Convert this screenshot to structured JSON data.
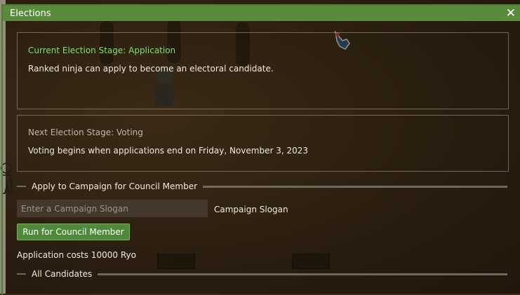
{
  "window": {
    "title": "Elections",
    "close_glyph": "✕"
  },
  "current_stage": {
    "heading": "Current Election Stage: Application",
    "description": "Ranked ninja can apply to become an electoral candidate."
  },
  "next_stage": {
    "heading": "Next Election Stage: Voting",
    "description": "Voting begins when applications end on Friday, November 3, 2023"
  },
  "apply_section": {
    "heading": "Apply to Campaign for Council Member",
    "slogan_placeholder": "Enter a Campaign Slogan",
    "slogan_value": "",
    "slogan_label": "Campaign Slogan",
    "run_button_label": "Run for Council Member",
    "cost_text": "Application costs 10000 Ryo"
  },
  "candidates_section": {
    "heading": "All Candidates"
  },
  "colors": {
    "title_bar": "#5a8a3b",
    "current_stage_text": "#7ee06a",
    "button_bg": "#4f8a3a"
  }
}
